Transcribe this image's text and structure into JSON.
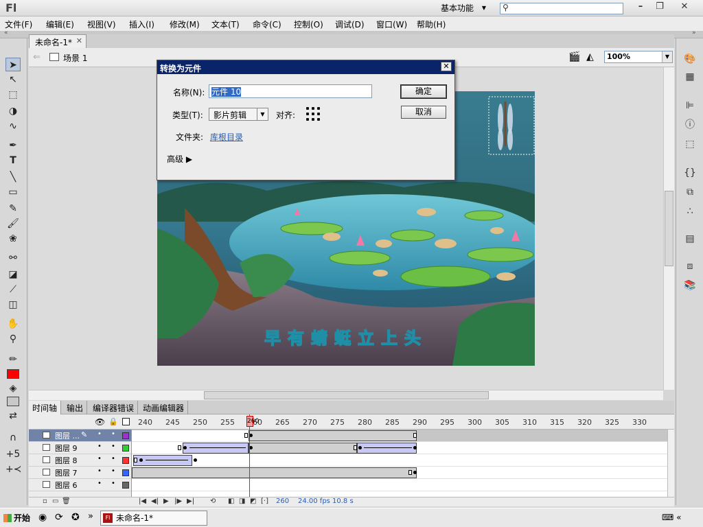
{
  "app": {
    "logo": "Fl",
    "workspace": "基本功能",
    "search_placeholder": ""
  },
  "menu": [
    "文件(F)",
    "编辑(E)",
    "视图(V)",
    "插入(I)",
    "修改(M)",
    "文本(T)",
    "命令(C)",
    "控制(O)",
    "调试(D)",
    "窗口(W)",
    "帮助(H)"
  ],
  "document": {
    "tab_title": "未命名-1*",
    "scene": "场景 1",
    "zoom": "100%"
  },
  "dialog": {
    "title": "转换为元件",
    "name_label": "名称(N):",
    "name_value": "元件 10",
    "type_label": "类型(T):",
    "type_value": "影片剪辑",
    "align_label": "对齐:",
    "folder_label": "文件夹:",
    "folder_value": "库根目录",
    "advanced_label": "高级",
    "ok_label": "确定",
    "cancel_label": "取消"
  },
  "stage": {
    "caption": "早有蜻蜓立上头"
  },
  "timeline": {
    "tabs": [
      "时间轴",
      "输出",
      "编译器错误",
      "动画编辑器"
    ],
    "ruler": [
      "240",
      "245",
      "250",
      "255",
      "260",
      "265",
      "270",
      "275",
      "280",
      "285",
      "290",
      "295",
      "300",
      "305",
      "310",
      "315",
      "320",
      "325",
      "330"
    ],
    "current_frame": "260",
    "layers": [
      {
        "name": "图层 ...",
        "color": "#9933cc",
        "selected": true
      },
      {
        "name": "图层 9",
        "color": "#33cc33",
        "selected": false
      },
      {
        "name": "图层 8",
        "color": "#ff3333",
        "selected": false
      },
      {
        "name": "图层 7",
        "color": "#3366ff",
        "selected": false
      },
      {
        "name": "图层 6",
        "color": "#666666",
        "selected": false
      }
    ],
    "footer": {
      "frame": "260",
      "fps": "24.00 fps",
      "time": "10.8 s"
    }
  },
  "taskbar": {
    "start": "开始",
    "task": "未命名-1*"
  }
}
